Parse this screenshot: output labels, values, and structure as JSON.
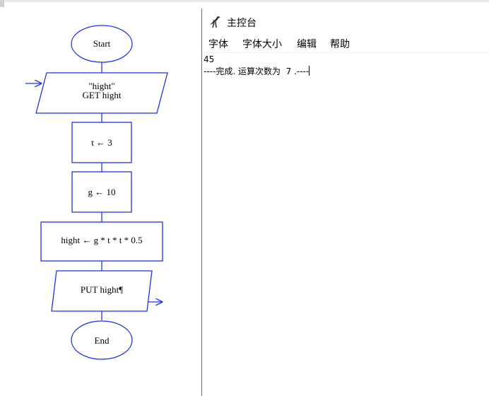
{
  "flowchart": {
    "start_label": "Start",
    "input_var": "\"hight\"",
    "input_stmt": "GET hight",
    "assign_t": "t ← 3",
    "assign_g": "g ← 10",
    "assign_hight": "hight ← g * t * t * 0.5",
    "output_stmt": "PUT hight¶",
    "end_label": "End"
  },
  "console": {
    "title": "主控台",
    "icon": "raptor-icon",
    "menu": {
      "font": "字体",
      "font_size": "字体大小",
      "edit": "编辑",
      "help": "帮助"
    },
    "output_line1": "45",
    "output_line2": "----完成. 运算次数为  7 .----"
  },
  "colors": {
    "flow_stroke": "#1f33e6",
    "console_border": "#1f7ad8"
  }
}
